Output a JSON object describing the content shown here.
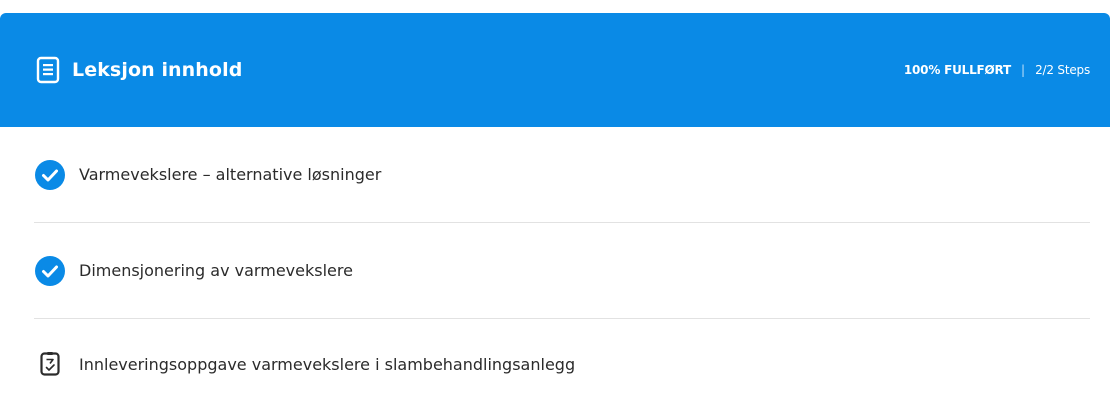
{
  "header": {
    "title": "Leksjon innhold",
    "progress": "100% FULLFØRT",
    "separator": "|",
    "steps": "2/2 Steps",
    "color": "#0a8ae6"
  },
  "items": [
    {
      "label": "Varmevekslere – alternative løsninger",
      "icon": "check-circle-icon",
      "status": "completed"
    },
    {
      "label": "Dimensjonering av varmevekslere",
      "icon": "check-circle-icon",
      "status": "completed"
    },
    {
      "label": "Innleveringsoppgave varmevekslere i slambehandlingsanlegg",
      "icon": "assignment-icon",
      "status": "incomplete"
    }
  ]
}
